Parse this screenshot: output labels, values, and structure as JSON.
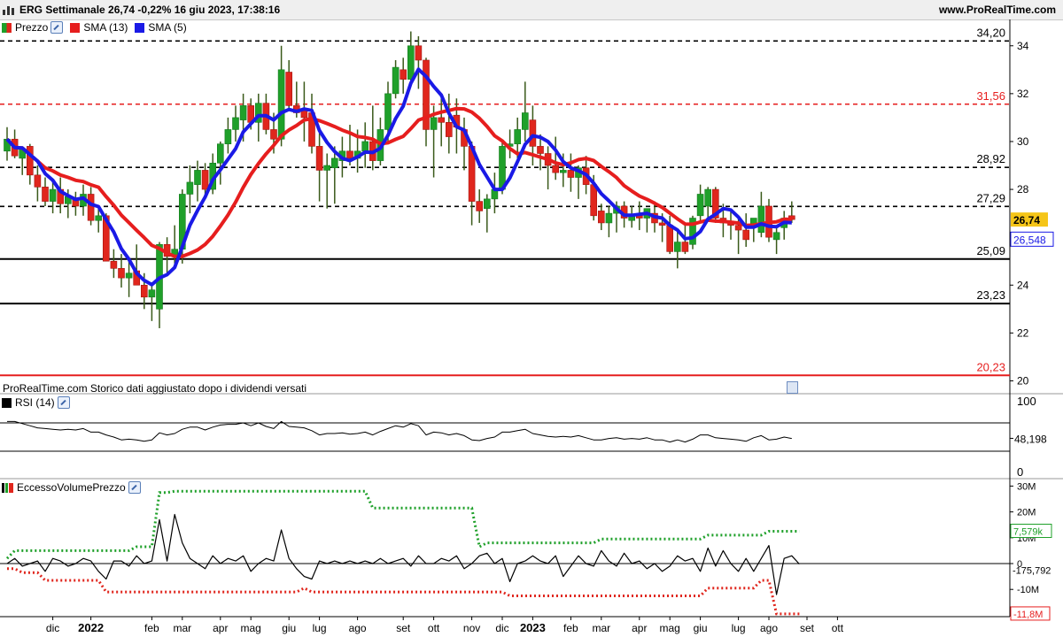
{
  "header": {
    "title": "ERG Settimanale 26,74 -0,22% 16 giu 2023, 17:38:16",
    "brand": "www.ProRealTime.com"
  },
  "note": "ProRealTime.com Storico dati aggiustato dopo i dividendi versati",
  "colors": {
    "up": "#1fa02a",
    "down": "#e0261d",
    "sma13": "#e61e1e",
    "sma5": "#1a1ae6",
    "last_price_badge": "#f5c518",
    "sma5_badge": "#1a1ae6"
  },
  "chart_data": [
    {
      "type": "candlestick",
      "panel": "price",
      "legend": [
        {
          "label": "Prezzo",
          "color": "#1fa02a"
        },
        {
          "label": "SMA (13)",
          "color": "#e61e1e"
        },
        {
          "label": "SMA (5)",
          "color": "#1a1ae6"
        }
      ],
      "y_ticks": [
        20,
        22,
        24,
        26,
        28,
        30,
        32,
        34
      ],
      "y_tick_labels": [
        "20",
        "22",
        "24",
        "26",
        "28",
        "30",
        "32",
        "34"
      ],
      "ylim": [
        19.5,
        35.1
      ],
      "x_labels": [
        "dic",
        "2022",
        "feb",
        "mar",
        "apr",
        "mag",
        "giu",
        "lug",
        "ago",
        "set",
        "ott",
        "nov",
        "dic",
        "2023",
        "feb",
        "mar",
        "apr",
        "mag",
        "giu",
        "lug",
        "ago",
        "set",
        "ott"
      ],
      "x_label_week_index": [
        6,
        11,
        19,
        23,
        28,
        32,
        37,
        41,
        46,
        52,
        56,
        61,
        65,
        69,
        74,
        78,
        83,
        87,
        91,
        96,
        100,
        105,
        109
      ],
      "x_label_bold": [
        "2022",
        "2023"
      ],
      "levels": [
        {
          "value": 34.2,
          "label": "34,20",
          "style": "dashed",
          "color": "#000000"
        },
        {
          "value": 31.56,
          "label": "31,56",
          "style": "dashed",
          "color": "#e61e1e"
        },
        {
          "value": 28.92,
          "label": "28,92",
          "style": "dashed",
          "color": "#000000"
        },
        {
          "value": 27.29,
          "label": "27,29",
          "style": "dashed",
          "color": "#000000"
        },
        {
          "value": 25.09,
          "label": "25,09",
          "style": "solid",
          "color": "#000000"
        },
        {
          "value": 23.23,
          "label": "23,23",
          "style": "solid",
          "color": "#000000"
        },
        {
          "value": 20.23,
          "label": "20,23",
          "style": "solid",
          "color": "#e61e1e"
        }
      ],
      "last_price": {
        "value": 26.74,
        "label": "26,74"
      },
      "sma5_last": {
        "value": 26.548,
        "label": "26,548"
      },
      "candles": [
        [
          29.6,
          30.6,
          29.2,
          30.1
        ],
        [
          30.1,
          30.5,
          29.3,
          29.4
        ],
        [
          29.3,
          29.8,
          28.6,
          29.7
        ],
        [
          29.8,
          29.9,
          28.2,
          28.6
        ],
        [
          28.6,
          29.0,
          27.5,
          28.1
        ],
        [
          28.1,
          28.5,
          27.3,
          27.5
        ],
        [
          27.5,
          28.4,
          27.0,
          28.0
        ],
        [
          28.0,
          28.5,
          27.0,
          27.4
        ],
        [
          27.4,
          28.0,
          26.8,
          27.7
        ],
        [
          27.6,
          27.9,
          26.9,
          27.3
        ],
        [
          27.3,
          28.2,
          26.9,
          27.8
        ],
        [
          27.8,
          28.1,
          26.5,
          26.7
        ],
        [
          26.7,
          27.2,
          26.2,
          26.9
        ],
        [
          26.9,
          27.0,
          25.0,
          25.0
        ],
        [
          25.0,
          25.5,
          24.3,
          24.7
        ],
        [
          24.7,
          25.3,
          23.9,
          24.3
        ],
        [
          24.3,
          25.0,
          23.5,
          24.5
        ],
        [
          24.6,
          25.7,
          24.0,
          24.0
        ],
        [
          24.0,
          24.5,
          23.0,
          23.5
        ],
        [
          23.5,
          24.0,
          22.5,
          23.8
        ],
        [
          23.0,
          25.8,
          22.2,
          25.7
        ],
        [
          25.7,
          26.0,
          24.5,
          25.2
        ],
        [
          25.2,
          26.5,
          24.9,
          25.5
        ],
        [
          25.5,
          28.0,
          24.9,
          27.8
        ],
        [
          27.8,
          29.0,
          27.0,
          28.3
        ],
        [
          28.2,
          29.2,
          27.5,
          28.8
        ],
        [
          28.8,
          29.1,
          27.7,
          28.0
        ],
        [
          28.0,
          29.5,
          27.8,
          29.1
        ],
        [
          29.1,
          30.0,
          28.2,
          29.9
        ],
        [
          29.9,
          31.0,
          29.5,
          30.5
        ],
        [
          30.5,
          31.5,
          30.0,
          31.0
        ],
        [
          30.9,
          32.0,
          30.0,
          31.5
        ],
        [
          31.5,
          31.8,
          30.5,
          30.8
        ],
        [
          30.8,
          32.0,
          30.0,
          31.6
        ],
        [
          31.6,
          32.0,
          30.3,
          30.5
        ],
        [
          30.5,
          31.2,
          29.5,
          30.1
        ],
        [
          30.1,
          34.0,
          29.8,
          33.0
        ],
        [
          32.9,
          33.4,
          31.4,
          31.5
        ],
        [
          31.5,
          32.5,
          31.0,
          31.2
        ],
        [
          31.3,
          32.5,
          30.0,
          31.0
        ],
        [
          31.2,
          32.0,
          29.5,
          29.8
        ],
        [
          29.8,
          30.5,
          27.5,
          28.8
        ],
        [
          28.8,
          29.5,
          27.2,
          29.0
        ],
        [
          28.9,
          29.8,
          27.4,
          29.3
        ],
        [
          29.2,
          30.2,
          28.5,
          29.6
        ],
        [
          29.6,
          30.7,
          29.0,
          29.3
        ],
        [
          29.3,
          30.5,
          28.7,
          29.6
        ],
        [
          29.6,
          30.8,
          28.9,
          30.0
        ],
        [
          30.0,
          31.5,
          28.8,
          29.2
        ],
        [
          29.2,
          31.0,
          29.0,
          30.5
        ],
        [
          30.5,
          32.5,
          30.0,
          32.0
        ],
        [
          32.0,
          33.4,
          31.8,
          33.1
        ],
        [
          33.0,
          33.5,
          32.0,
          32.6
        ],
        [
          32.6,
          34.6,
          32.4,
          34.0
        ],
        [
          34.0,
          34.4,
          32.2,
          33.4
        ],
        [
          33.4,
          33.5,
          29.8,
          30.5
        ],
        [
          30.5,
          31.5,
          28.5,
          31.0
        ],
        [
          31.0,
          31.8,
          29.8,
          30.8
        ],
        [
          30.8,
          32.0,
          29.5,
          30.2
        ],
        [
          31.1,
          31.8,
          29.5,
          30.6
        ],
        [
          30.5,
          31.0,
          28.8,
          29.8
        ],
        [
          29.8,
          30.0,
          26.5,
          27.5
        ],
        [
          27.5,
          28.0,
          26.6,
          27.1
        ],
        [
          27.2,
          27.8,
          26.2,
          27.6
        ],
        [
          27.6,
          28.7,
          27.0,
          28.0
        ],
        [
          28.0,
          30.0,
          27.8,
          29.8
        ],
        [
          29.8,
          30.5,
          29.3,
          29.9
        ],
        [
          29.9,
          31.0,
          29.3,
          30.5
        ],
        [
          30.5,
          32.5,
          30.0,
          31.2
        ],
        [
          30.9,
          31.5,
          29.0,
          29.8
        ],
        [
          29.8,
          30.3,
          28.8,
          29.5
        ],
        [
          29.5,
          29.8,
          28.0,
          29.0
        ],
        [
          29.0,
          30.2,
          28.4,
          28.7
        ],
        [
          28.7,
          29.5,
          28.1,
          28.8
        ],
        [
          28.8,
          29.5,
          27.9,
          28.5
        ],
        [
          28.5,
          29.0,
          27.6,
          28.9
        ],
        [
          28.9,
          29.4,
          27.8,
          28.2
        ],
        [
          28.2,
          28.6,
          26.7,
          26.9
        ],
        [
          27.1,
          27.4,
          26.3,
          26.6
        ],
        [
          26.6,
          27.3,
          26.0,
          27.0
        ],
        [
          27.0,
          27.5,
          26.2,
          27.3
        ],
        [
          27.3,
          27.5,
          26.4,
          26.8
        ],
        [
          26.7,
          27.3,
          26.4,
          26.9
        ],
        [
          26.9,
          27.5,
          26.3,
          26.8
        ],
        [
          26.8,
          27.2,
          26.2,
          27.2
        ],
        [
          27.0,
          27.5,
          26.2,
          26.6
        ],
        [
          26.6,
          27.0,
          25.8,
          26.5
        ],
        [
          26.5,
          26.9,
          25.3,
          25.4
        ],
        [
          25.4,
          26.3,
          24.7,
          25.8
        ],
        [
          25.8,
          26.5,
          25.3,
          25.4
        ],
        [
          25.7,
          26.9,
          25.5,
          26.8
        ],
        [
          26.9,
          28.2,
          26.7,
          27.8
        ],
        [
          27.3,
          28.1,
          26.8,
          28.0
        ],
        [
          28.0,
          28.1,
          26.6,
          26.8
        ],
        [
          26.8,
          27.4,
          26.0,
          26.6
        ],
        [
          26.6,
          27.1,
          25.9,
          26.5
        ],
        [
          26.5,
          26.8,
          25.3,
          26.3
        ],
        [
          26.3,
          27.0,
          25.6,
          25.9
        ],
        [
          26.4,
          26.8,
          25.8,
          26.8
        ],
        [
          26.2,
          27.9,
          26.0,
          27.3
        ],
        [
          27.3,
          27.6,
          25.8,
          26.0
        ],
        [
          25.9,
          26.4,
          25.3,
          26.2
        ],
        [
          26.4,
          27.1,
          25.9,
          26.8
        ],
        [
          26.9,
          27.5,
          26.6,
          26.74
        ]
      ]
    },
    {
      "type": "line",
      "panel": "rsi",
      "legend": [
        {
          "label": "RSI (14)",
          "color": "#000000"
        }
      ],
      "y_ticks": [
        0,
        100
      ],
      "y_tick_labels": [
        "0",
        "100"
      ],
      "ylim": [
        0,
        100
      ],
      "band": [
        30,
        70
      ],
      "last": {
        "value": 48.198,
        "label": "48,198"
      },
      "values": [
        72,
        72,
        69,
        66,
        63,
        62,
        61,
        60,
        61,
        60,
        62,
        57,
        57,
        53,
        50,
        46,
        47,
        46,
        44,
        46,
        56,
        53,
        55,
        61,
        64,
        64,
        60,
        64,
        67,
        68,
        68,
        70,
        66,
        70,
        65,
        62,
        72,
        65,
        64,
        63,
        59,
        53,
        55,
        55,
        56,
        54,
        55,
        57,
        53,
        58,
        62,
        66,
        64,
        69,
        66,
        53,
        57,
        56,
        53,
        55,
        52,
        46,
        45,
        48,
        50,
        57,
        57,
        59,
        61,
        55,
        53,
        51,
        50,
        51,
        50,
        52,
        49,
        46,
        46,
        48,
        49,
        47,
        48,
        47,
        49,
        46,
        46,
        43,
        46,
        43,
        47,
        53,
        53,
        49,
        48,
        47,
        46,
        44,
        49,
        52,
        46,
        47,
        50,
        48
      ]
    },
    {
      "type": "line",
      "panel": "volume-excess",
      "legend": [
        {
          "label": "EccessoVolumePrezzo",
          "color": "#000000"
        }
      ],
      "y_ticks": [
        -20,
        -10,
        0,
        10,
        20,
        30
      ],
      "y_tick_labels": [
        "-20M",
        "-10M",
        "0",
        "10M",
        "20M",
        "30M"
      ],
      "ylim": [
        -21.5,
        32
      ],
      "upper": {
        "label": "7,579k",
        "color": "#1fa02a"
      },
      "lower": {
        "label": "-11,8M",
        "color": "#e61e1e"
      },
      "last": {
        "label": "-175,792",
        "color": "#000000"
      },
      "values": [
        0,
        2,
        -1,
        0,
        1,
        -3,
        2,
        1,
        -1,
        0,
        2,
        1,
        -3,
        -6,
        1,
        1,
        -1,
        3,
        0,
        1,
        17,
        1,
        19,
        8,
        2,
        0,
        -2,
        3,
        0,
        2,
        1,
        3,
        -3,
        0,
        2,
        1,
        13,
        2,
        -2,
        -5,
        -6,
        1,
        0,
        1,
        0,
        1,
        0,
        1,
        0,
        2,
        0,
        1,
        2,
        -1,
        3,
        0,
        0,
        2,
        1,
        3,
        -2,
        0,
        3,
        4,
        0,
        2,
        -7,
        0,
        1,
        3,
        1,
        0,
        3,
        -5,
        -1,
        3,
        0,
        -1,
        5,
        1,
        -1,
        4,
        0,
        1,
        -2,
        0,
        -3,
        -1,
        3,
        1,
        2,
        -3,
        6,
        -1,
        5,
        0,
        -3,
        2,
        -3,
        2,
        7,
        -12,
        2,
        3,
        -0.2
      ],
      "upper_band": [
        30,
        30,
        30,
        30,
        30,
        30,
        30,
        30,
        30,
        30,
        30,
        30,
        30,
        30,
        30,
        30,
        30,
        30,
        30,
        30,
        30,
        30,
        30,
        30,
        30,
        30,
        30,
        30,
        30,
        30,
        30,
        30,
        30,
        30,
        30,
        30,
        30,
        30,
        30,
        30,
        30,
        30,
        30,
        30,
        30,
        30,
        30,
        30,
        30,
        30,
        30,
        30,
        30,
        30,
        30,
        30,
        30,
        30,
        30,
        30,
        30,
        30,
        30,
        30,
        30,
        30,
        30,
        30,
        30,
        30,
        30,
        30,
        30,
        30,
        30,
        30,
        30,
        30,
        30,
        30,
        30,
        30,
        30,
        30,
        30,
        30,
        30,
        30,
        30,
        30,
        30,
        30,
        30,
        30,
        30,
        30,
        30,
        30,
        30,
        30,
        30,
        30,
        30,
        30,
        30
      ]
    }
  ]
}
